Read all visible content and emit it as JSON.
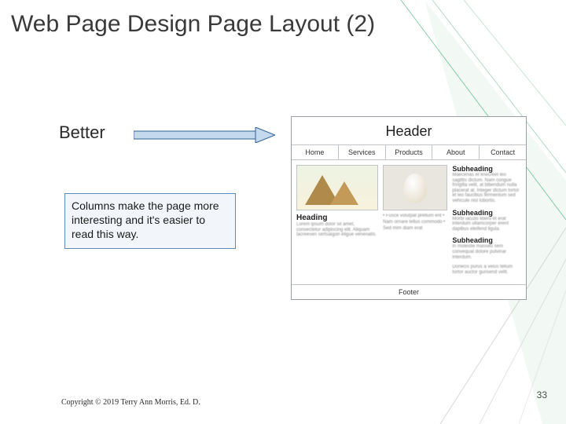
{
  "title": "Web Page Design Page Layout (2)",
  "better_label": "Better",
  "caption": "Columns make the page more interesting and it's easier to read this way.",
  "wireframe": {
    "header": "Header",
    "nav": [
      "Home",
      "Services",
      "Products",
      "About",
      "Contact"
    ],
    "left": {
      "heading": "Heading",
      "text": "Lorem ipsum dolor sit amet, consectetur adipiscing elit. Aliquam lacreesen sertsaigon eligue venenatis."
    },
    "mid": {
      "bullets": "• Fusce volutpat pretium erit\n• Nam ornare tellus commodo\n• Sed mim diam erat"
    },
    "right": {
      "sub1": "Subheading",
      "text1": "Maecenas et linecreet leo sagittis dictum. Nam congue fringilla velit, at bibendum nulla placerat at. Integer dictum tortor et leo faucibus fermentum sed vehicule nisl lobortis.",
      "sub2": "Subheading",
      "text2": "Morbi iaculis libero et erat interdum ullamcorper erent dapibus eleifend ligula.",
      "sub3": "Subheading",
      "text3": "In molestie masseu sem convequat dolore pulvinar interdum.",
      "text4": "Donecis purus a velus tellum tortor auctor gurisend velit."
    },
    "footer": "Footer"
  },
  "copyright": "Copyright © 2019 Terry Ann Morris, Ed. D.",
  "page_number": "33"
}
